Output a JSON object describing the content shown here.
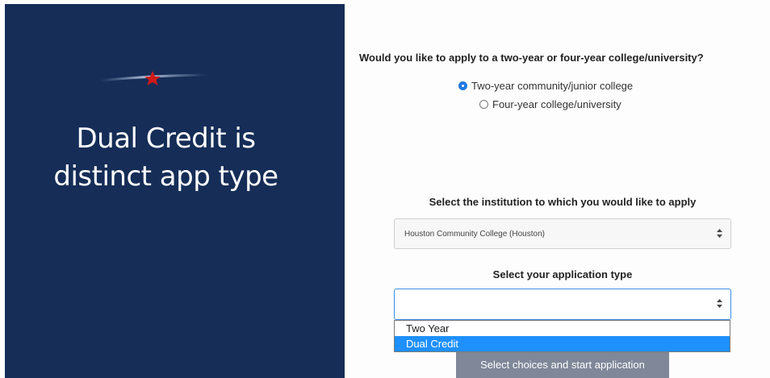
{
  "slide": {
    "title_line1": "Dual Credit is",
    "title_line2": "distinct app type",
    "background_color": "#152d57",
    "star_color": "#d11a1a",
    "icon": "star-streak-icon"
  },
  "form": {
    "question": "Would you like to apply to a two-year or four-year college/university?",
    "options": [
      {
        "label": "Two-year community/junior college",
        "checked": true
      },
      {
        "label": "Four-year college/university",
        "checked": false
      }
    ],
    "institution_label": "Select the institution to which you would like to apply",
    "institution_value": "Houston Community College (Houston)",
    "application_type_label": "Select your application type",
    "application_type_value": "",
    "application_type_options": [
      "Two Year",
      "Dual Credit"
    ],
    "highlighted_option": "Dual Credit",
    "start_button": "Select choices and start application",
    "select_arrow_icon": "updown-chevron-icon"
  },
  "colors": {
    "accent": "#1e90ff",
    "button": "#7f8798",
    "focus_border": "#3b8ee8"
  }
}
